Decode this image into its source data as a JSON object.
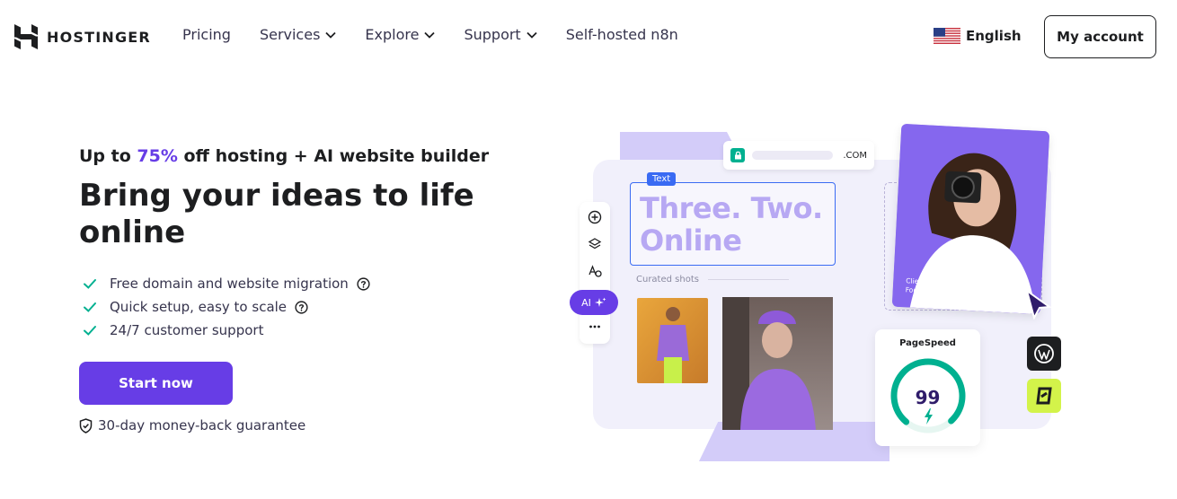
{
  "brand": {
    "name": "HOSTINGER"
  },
  "nav": {
    "items": [
      {
        "label": "Pricing",
        "has_dropdown": false
      },
      {
        "label": "Services",
        "has_dropdown": true
      },
      {
        "label": "Explore",
        "has_dropdown": true
      },
      {
        "label": "Support",
        "has_dropdown": true
      },
      {
        "label": "Self-hosted n8n",
        "has_dropdown": false
      }
    ],
    "language": "English",
    "language_icon": "us-flag-icon",
    "account_label": "My account"
  },
  "hero": {
    "promo_prefix": "Up to ",
    "promo_accent": "75%",
    "promo_suffix": " off hosting + AI website builder",
    "title": "Bring your ideas to life online",
    "features": [
      {
        "text": "Free domain and website migration",
        "has_help": true
      },
      {
        "text": "Quick setup, easy to scale",
        "has_help": true
      },
      {
        "text": "24/7 customer support",
        "has_help": false
      }
    ],
    "cta_label": "Start now",
    "guarantee": "30-day money-back guarantee"
  },
  "illustration": {
    "url_tld": ".COM",
    "text_label": "Text",
    "headline_line1": "Three. Two.",
    "headline_line2": "Online",
    "curated_label": "Curated shots",
    "ai_label": "AI",
    "client_line1": "Client: Anna Franques",
    "client_line2": "Founder of annafranques.com",
    "pagespeed_label": "PageSpeed",
    "pagespeed_score": "99",
    "pagespeed_value": 99
  },
  "colors": {
    "accent": "#673de6",
    "text": "#1d1e20",
    "check": "#00b090",
    "lime": "#d3f34a"
  }
}
